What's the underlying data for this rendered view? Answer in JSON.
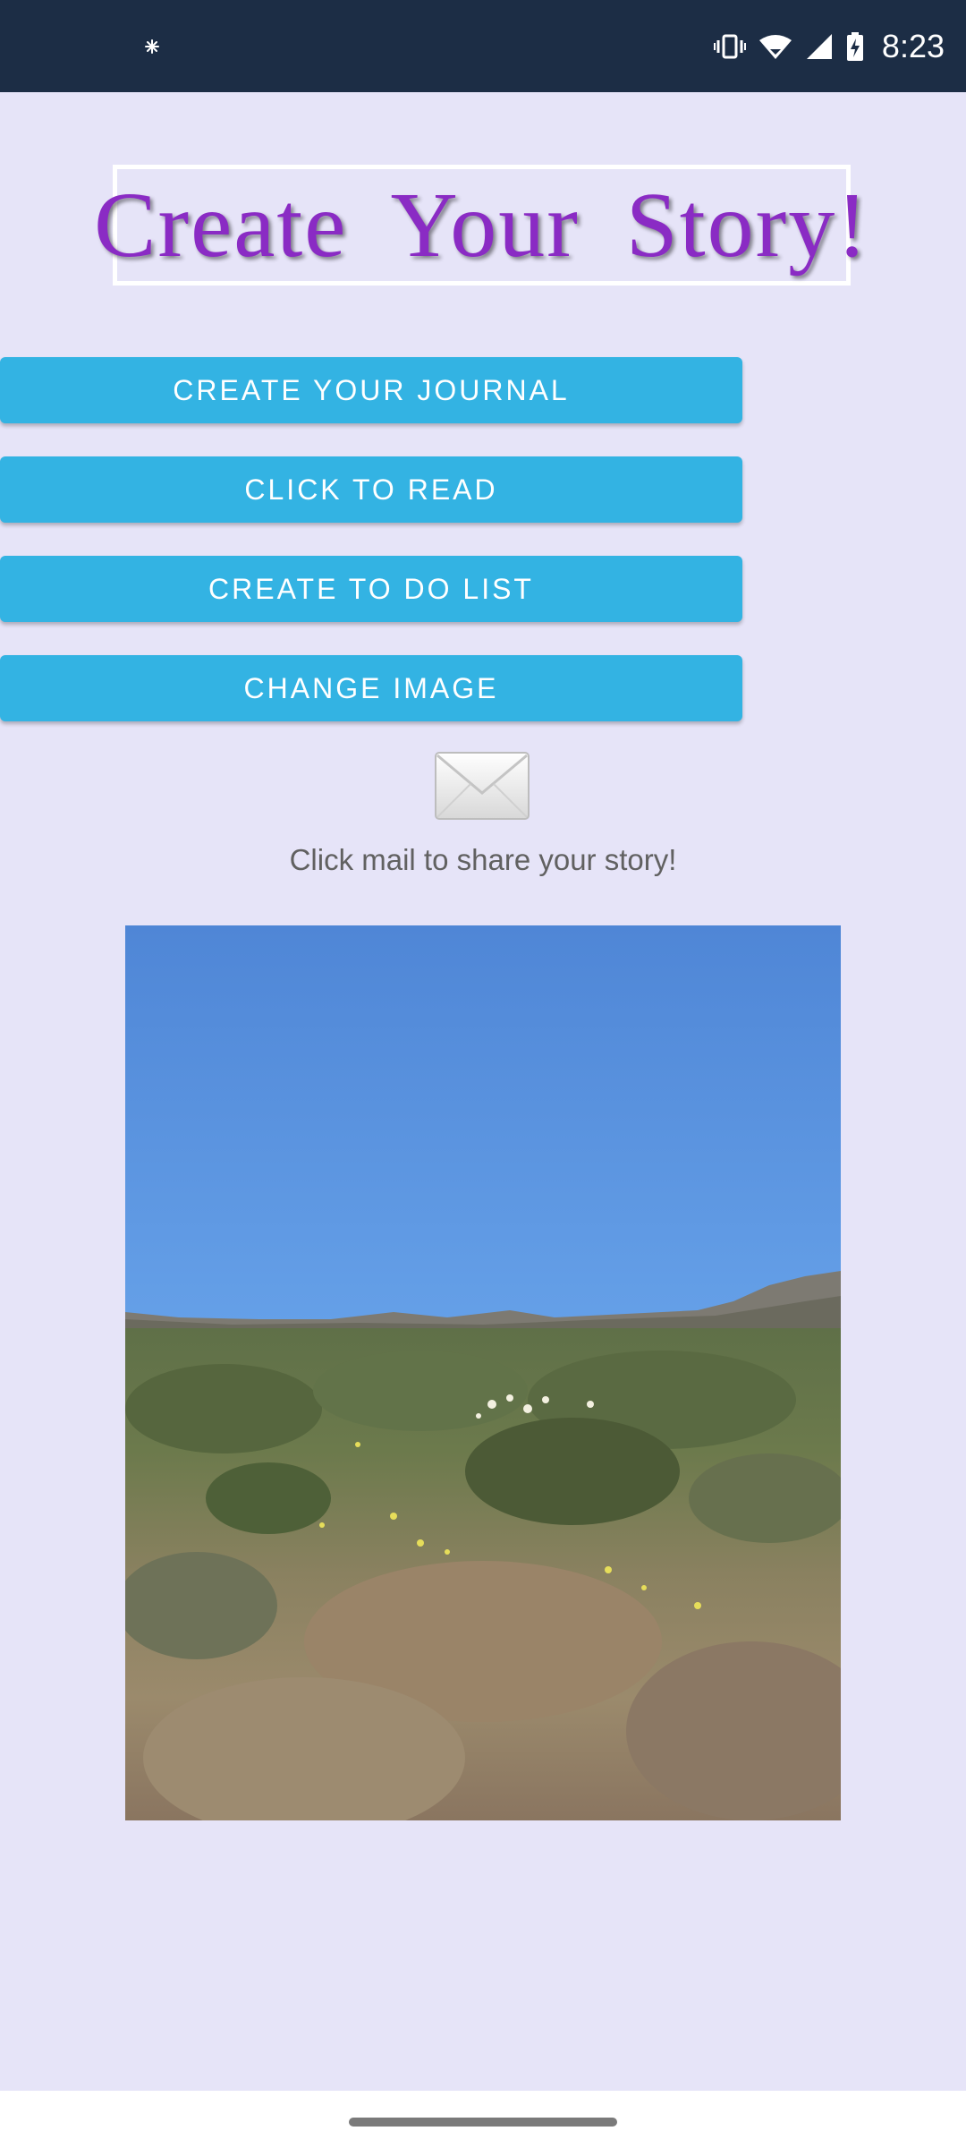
{
  "status_bar": {
    "time": "8:23",
    "icons": [
      "notification-sparkle-icon",
      "vibrate-icon",
      "wifi-icon",
      "signal-icon",
      "battery-charging-icon"
    ]
  },
  "title": {
    "text": "Create Your Story!",
    "color": "#8a2bc4"
  },
  "buttons": {
    "journal": "CREATE YOUR JOURNAL",
    "read": "CLICK TO READ",
    "todo": "CREATE TO DO LIST",
    "change_image": "CHANGE IMAGE"
  },
  "share": {
    "icon": "mail-icon",
    "caption": "Click mail to share your story!"
  },
  "colors": {
    "background": "#e6e4f8",
    "status_bar": "#1c2d45",
    "button": "#33b3e3"
  }
}
